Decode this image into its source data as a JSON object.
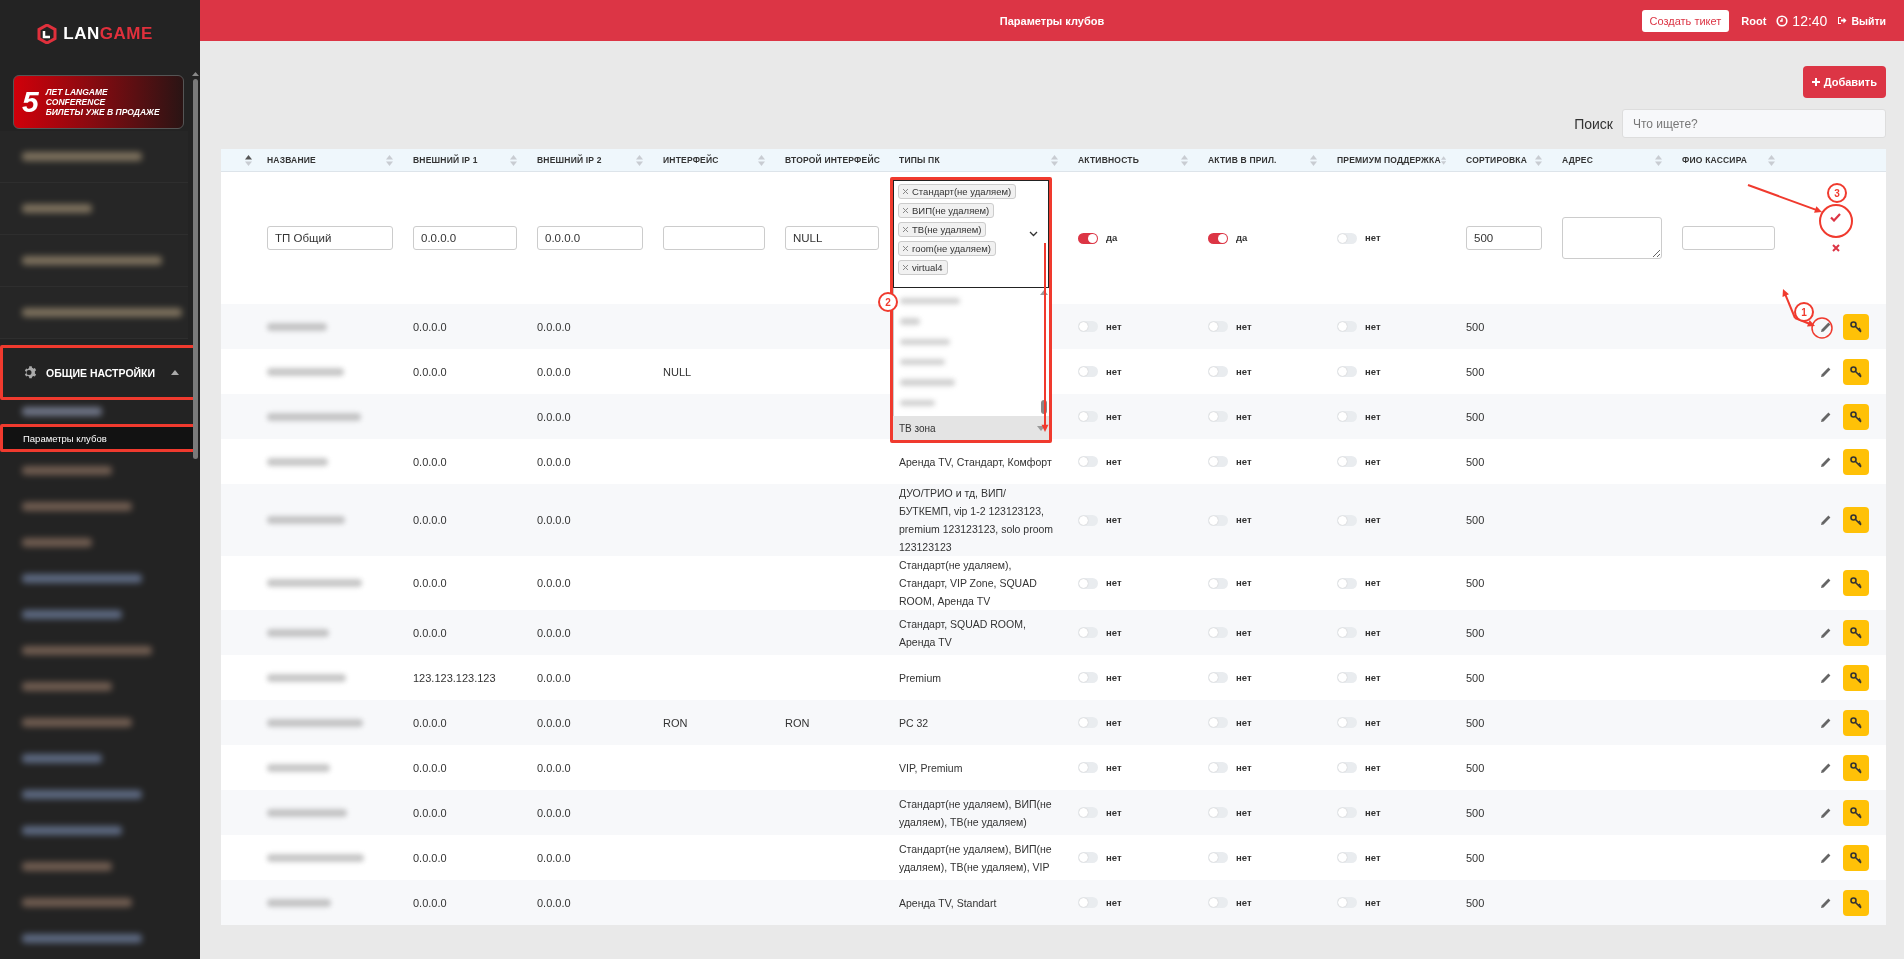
{
  "sidebar": {
    "logo": {
      "plain": "LAN",
      "accent": "GAME"
    },
    "banner": {
      "number": "5",
      "lines": [
        "ЛЕТ LANGAME",
        "CONFERENCE",
        "БИЛЕТЫ УЖЕ В ПРОДАЖЕ"
      ]
    },
    "section": {
      "label": "ОБЩИЕ НАСТРОЙКИ",
      "expanded": true,
      "annotated": true,
      "children": [
        {
          "label": "Параметры клубов",
          "selected": true,
          "annotated": true
        }
      ]
    }
  },
  "header": {
    "title": "Параметры клубов",
    "ticket_button": "Создать тикет",
    "user": "Root",
    "time": "12:40",
    "logout": "Выйти"
  },
  "toolbar": {
    "add_button": "Добавить",
    "search_label": "Поиск",
    "search": {
      "placeholder": "Что ищете?"
    }
  },
  "table": {
    "sorted_ascending": true,
    "columns": [
      "НАЗВАНИЕ",
      "ВНЕШНИЙ IP 1",
      "ВНЕШНИЙ IP 2",
      "ИНТЕРФЕЙС",
      "ВТОРОЙ ИНТЕРФЕЙС",
      "ТИПЫ ПК",
      "АКТИВНОСТЬ",
      "АКТИВ В ПРИЛ.",
      "ПРЕМИУМ ПОДДЕРЖКА",
      "СОРТИРОВКА",
      "АДРЕС",
      "ФИО КАССИРА"
    ],
    "edit_row": {
      "name": "ТП Общий",
      "ip1": "0.0.0.0",
      "ip2": "0.0.0.0",
      "second_interface": "NULL",
      "pc_types": {
        "annotated": true,
        "tags": [
          "Стандарт(не удаляем)",
          "ВИП(не удаляем)",
          "ТВ(не удаляем)",
          "room(не удаляем)",
          "virtual4"
        ],
        "options": [
          {
            "label": "ТВ зона",
            "selected": true
          }
        ]
      },
      "toggles": [
        {
          "on": true,
          "label": "да"
        },
        {
          "on": true,
          "label": "да"
        },
        {
          "on": false,
          "label": "нет"
        }
      ],
      "sort": "500"
    },
    "rows": [
      {
        "ip1": "0.0.0.0",
        "ip2": "0.0.0.0",
        "toggles": [
          {
            "on": false,
            "label": "нет"
          },
          {
            "on": false,
            "label": "нет"
          },
          {
            "on": false,
            "label": "нет"
          }
        ],
        "sort": "500"
      },
      {
        "ip1": "0.0.0.0",
        "ip2": "0.0.0.0",
        "interface": "NULL",
        "toggles": [
          {
            "on": false,
            "label": "нет"
          },
          {
            "on": false,
            "label": "нет"
          },
          {
            "on": false,
            "label": "нет"
          }
        ],
        "sort": "500"
      },
      {
        "ip2": "0.0.0.0",
        "toggles": [
          {
            "on": false,
            "label": "нет"
          },
          {
            "on": false,
            "label": "нет"
          },
          {
            "on": false,
            "label": "нет"
          }
        ],
        "sort": "500"
      },
      {
        "ip1": "0.0.0.0",
        "ip2": "0.0.0.0",
        "pc_types": "Аренда TV, Стандарт, Комфорт",
        "toggles": [
          {
            "on": false,
            "label": "нет"
          },
          {
            "on": false,
            "label": "нет"
          },
          {
            "on": false,
            "label": "нет"
          }
        ],
        "sort": "500"
      },
      {
        "ip1": "0.0.0.0",
        "ip2": "0.0.0.0",
        "pc_types": "ДУО/ТРИО и тд, ВИП/ БУТКЕМП, vip 1-2 123123123, premium 123123123, solo proom 123123123",
        "toggles": [
          {
            "on": false,
            "label": "нет"
          },
          {
            "on": false,
            "label": "нет"
          },
          {
            "on": false,
            "label": "нет"
          }
        ],
        "sort": "500"
      },
      {
        "ip1": "0.0.0.0",
        "ip2": "0.0.0.0",
        "pc_types": "Стандарт(не удаляем), Стандарт, VIP Zone, SQUAD ROOM, Аренда TV",
        "toggles": [
          {
            "on": false,
            "label": "нет"
          },
          {
            "on": false,
            "label": "нет"
          },
          {
            "on": false,
            "label": "нет"
          }
        ],
        "sort": "500"
      },
      {
        "ip1": "0.0.0.0",
        "ip2": "0.0.0.0",
        "pc_types": "Стандарт, SQUAD ROOM, Аренда TV",
        "toggles": [
          {
            "on": false,
            "label": "нет"
          },
          {
            "on": false,
            "label": "нет"
          },
          {
            "on": false,
            "label": "нет"
          }
        ],
        "sort": "500"
      },
      {
        "ip1": "123.123.123.123",
        "ip2": "0.0.0.0",
        "pc_types": "Premium",
        "toggles": [
          {
            "on": false,
            "label": "нет"
          },
          {
            "on": false,
            "label": "нет"
          },
          {
            "on": false,
            "label": "нет"
          }
        ],
        "sort": "500"
      },
      {
        "ip1": "0.0.0.0",
        "ip2": "0.0.0.0",
        "interface": "RON",
        "second_interface": "RON",
        "pc_types": "PC 32",
        "toggles": [
          {
            "on": false,
            "label": "нет"
          },
          {
            "on": false,
            "label": "нет"
          },
          {
            "on": false,
            "label": "нет"
          }
        ],
        "sort": "500"
      },
      {
        "ip1": "0.0.0.0",
        "ip2": "0.0.0.0",
        "pc_types": "VIP, Premium",
        "toggles": [
          {
            "on": false,
            "label": "нет"
          },
          {
            "on": false,
            "label": "нет"
          },
          {
            "on": false,
            "label": "нет"
          }
        ],
        "sort": "500"
      },
      {
        "ip1": "0.0.0.0",
        "ip2": "0.0.0.0",
        "pc_types": "Стандарт(не удаляем), ВИП(не удаляем), ТВ(не удаляем)",
        "toggles": [
          {
            "on": false,
            "label": "нет"
          },
          {
            "on": false,
            "label": "нет"
          },
          {
            "on": false,
            "label": "нет"
          }
        ],
        "sort": "500"
      },
      {
        "ip1": "0.0.0.0",
        "ip2": "0.0.0.0",
        "pc_types": "Стандарт(не удаляем), ВИП(не удаляем), ТВ(не удаляем), VIP",
        "toggles": [
          {
            "on": false,
            "label": "нет"
          },
          {
            "on": false,
            "label": "нет"
          },
          {
            "on": false,
            "label": "нет"
          }
        ],
        "sort": "500"
      },
      {
        "ip1": "0.0.0.0",
        "ip2": "0.0.0.0",
        "pc_types": "Аренда TV, Standart",
        "toggles": [
          {
            "on": false,
            "label": "нет"
          },
          {
            "on": false,
            "label": "нет"
          },
          {
            "on": false,
            "label": "нет"
          }
        ],
        "sort": "500"
      }
    ]
  },
  "annotations": {
    "markers": [
      "1",
      "2",
      "3"
    ]
  }
}
